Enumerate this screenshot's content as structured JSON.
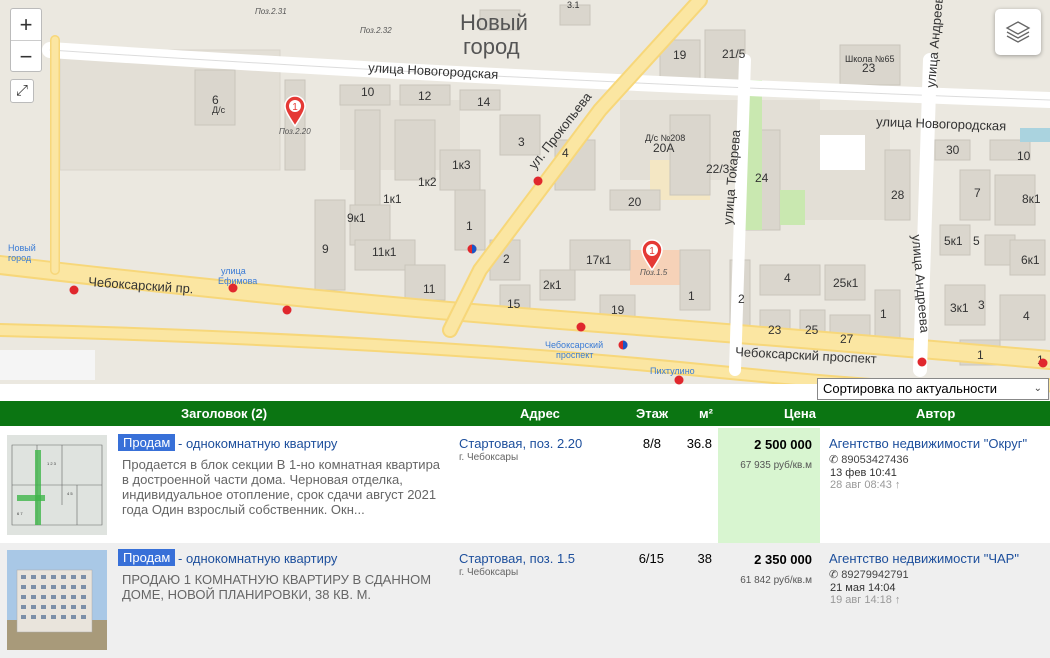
{
  "map": {
    "district_title_line1": "Новый",
    "district_title_line2": "город",
    "streets": {
      "novogorodskaya_1": "улица Новогородская",
      "novogorodskaya_2": "улица Новогородская",
      "prokopeva": "ул. Прокопьева",
      "tokareva": "улица Токарева",
      "andreeva_1": "улица Андреева",
      "andreeva_2": "улица Андреева",
      "cheboksarsky_1": "Чебоксарский пр.",
      "cheboksarsky_2": "Чебоксарский проспект"
    },
    "stops": {
      "noviy_gorod_1": "Новый",
      "noviy_gorod_2": "город",
      "efimova_1": "улица",
      "efimova_2": "Ефимова",
      "prospect_1": "Чебоксарский",
      "prospect_2": "проспект",
      "pikhtulino": "Пихтулино"
    },
    "houses": [
      "6",
      "10",
      "12",
      "14",
      "19",
      "21/5",
      "23",
      "3",
      "4",
      "1к3",
      "1к2",
      "1к1",
      "9к1",
      "9",
      "11к1",
      "11",
      "1",
      "2",
      "15",
      "2к1",
      "17к1",
      "19",
      "1",
      "2",
      "4",
      "25к1",
      "23",
      "25",
      "27",
      "1",
      "20А",
      "22/3",
      "24",
      "20",
      "28",
      "30",
      "10",
      "7",
      "8к1",
      "5к1",
      "5",
      "6к1",
      "3к1",
      "3",
      "4",
      "1",
      "1",
      "3.1"
    ],
    "labels": {
      "pos_231": "Поз.2.31",
      "pos_232": "Поз.2.32",
      "school": "Школа №65",
      "kindergarten_6": "Д/с",
      "kindergarten_208": "Д/с №208",
      "marker_pos_220": "Поз.2.20",
      "marker_pos_15": "Поз.1.5"
    },
    "markers": [
      "1",
      "1"
    ]
  },
  "controls": {
    "zoom_in": "+",
    "zoom_out": "−",
    "fullscreen_icon": "fullscreen-icon",
    "layers_icon": "layers-icon"
  },
  "sort": {
    "selected": "Сортировка по актуальности"
  },
  "table": {
    "headers": {
      "title": "Заголовок (2)",
      "address": "Адрес",
      "floor": "Этаж",
      "area": "м²",
      "price": "Цена",
      "author": "Автор"
    },
    "rows": [
      {
        "badge": "Продам",
        "type": "- однокомнатную квартиру",
        "desc_lines": [
          "Продается в блок секции В 1-но комнатная квартира",
          "в достроенной части дома. Черновая отделка,",
          "индивидуальное отопление, срок сдачи август 2021",
          "года Один взрослый собственник. Окн..."
        ],
        "address": "Стартовая, поз. 2.20",
        "city": "г. Чебоксары",
        "floor": "8/8",
        "area": "36.8",
        "price": "2 500 000",
        "price_per_m": "67 935 руб/кв.м",
        "agent": "Агентство недвижимости \"Округ\"",
        "phone": "89053427436",
        "date_updated": "13 фев 10:41",
        "date_created": "28 авг 08:43 ↑",
        "price_bg": "#d8f5d0"
      },
      {
        "badge": "Продам",
        "type": "- однокомнатную квартиру",
        "desc_lines": [
          "ПРОДАЮ 1 КОМНАТНУЮ КВАРТИРУ В СДАННОМ",
          "ДОМЕ, НОВОЙ ПЛАНИРОВКИ, 38 КВ. М."
        ],
        "address": "Стартовая, поз. 1.5",
        "city": "г. Чебоксары",
        "floor": "6/15",
        "area": "38",
        "price": "2 350 000",
        "price_per_m": "61 842 руб/кв.м",
        "agent": "Агентство недвижимости \"ЧАР\"",
        "phone": "89279942791",
        "date_updated": "21 мая 14:04",
        "date_created": "19 авг 14:18 ↑",
        "price_bg": "#efefef"
      }
    ]
  },
  "colors": {
    "header_green": "#0b7512",
    "badge_blue": "#3870d8",
    "link_blue": "#1d4f9c",
    "road_yellow": "#fbe6a2",
    "marker_red": "#e53935"
  }
}
